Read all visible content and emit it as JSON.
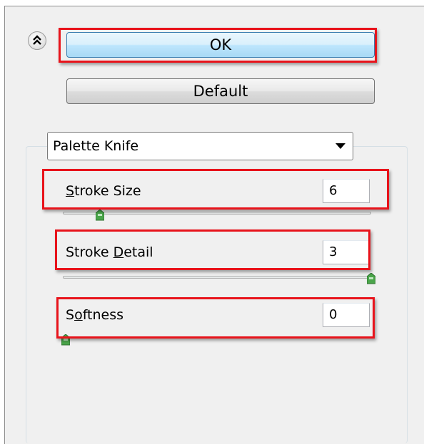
{
  "buttons": {
    "ok_label": "OK",
    "default_label": "Default"
  },
  "filter": {
    "selected": "Palette Knife"
  },
  "sliders": [
    {
      "label_pre": "",
      "label_key": "S",
      "label_post": "troke Size",
      "value": "6",
      "min": 0,
      "max": 50,
      "position": 6
    },
    {
      "label_pre": "Stroke ",
      "label_key": "D",
      "label_post": "etail",
      "value": "3",
      "min": 1,
      "max": 3,
      "position": 3
    },
    {
      "label_pre": "S",
      "label_key": "o",
      "label_post": "ftness",
      "value": "0",
      "min": 0,
      "max": 10,
      "position": 0
    }
  ],
  "icons": {
    "collapse": "double-chevron-up-icon",
    "dropdown": "dropdown-arrow-icon",
    "slider_thumb": "slider-thumb-icon"
  },
  "colors": {
    "highlight": "#e8131b",
    "ok_button": "#bee6fd",
    "thumb": "#4aa54a"
  }
}
